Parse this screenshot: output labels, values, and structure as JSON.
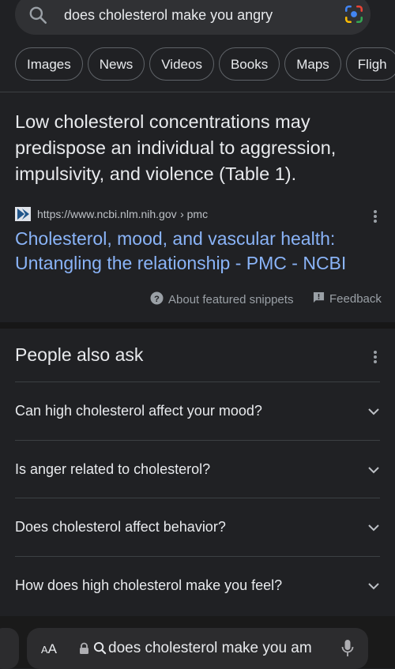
{
  "search": {
    "query": "does cholesterol make you angry"
  },
  "chips": [
    "Images",
    "News",
    "Videos",
    "Books",
    "Maps",
    "Fligh"
  ],
  "snippet": {
    "text": "Low cholesterol concentrations may predispose an individual to aggression, impulsivity, and violence (Table 1).",
    "source_url": "https://www.ncbi.nlm.nih.gov",
    "source_path": "› pmc",
    "title": "Cholesterol, mood, and vascular health: Untangling the relationship - PMC - NCBI",
    "about_label": "About featured snippets",
    "feedback_label": "Feedback"
  },
  "paa": {
    "title": "People also ask",
    "questions": [
      "Can high cholesterol affect your mood?",
      "Is anger related to cholesterol?",
      "Does cholesterol affect behavior?",
      "How does high cholesterol make you feel?"
    ]
  },
  "browser": {
    "aa_label_big": "A",
    "aa_label_small": "A",
    "address_text": "does cholesterol make you am"
  },
  "colors": {
    "background": "#202124",
    "link": "#8ab4f8",
    "text": "#e8eaed",
    "muted": "#9aa0a6"
  }
}
